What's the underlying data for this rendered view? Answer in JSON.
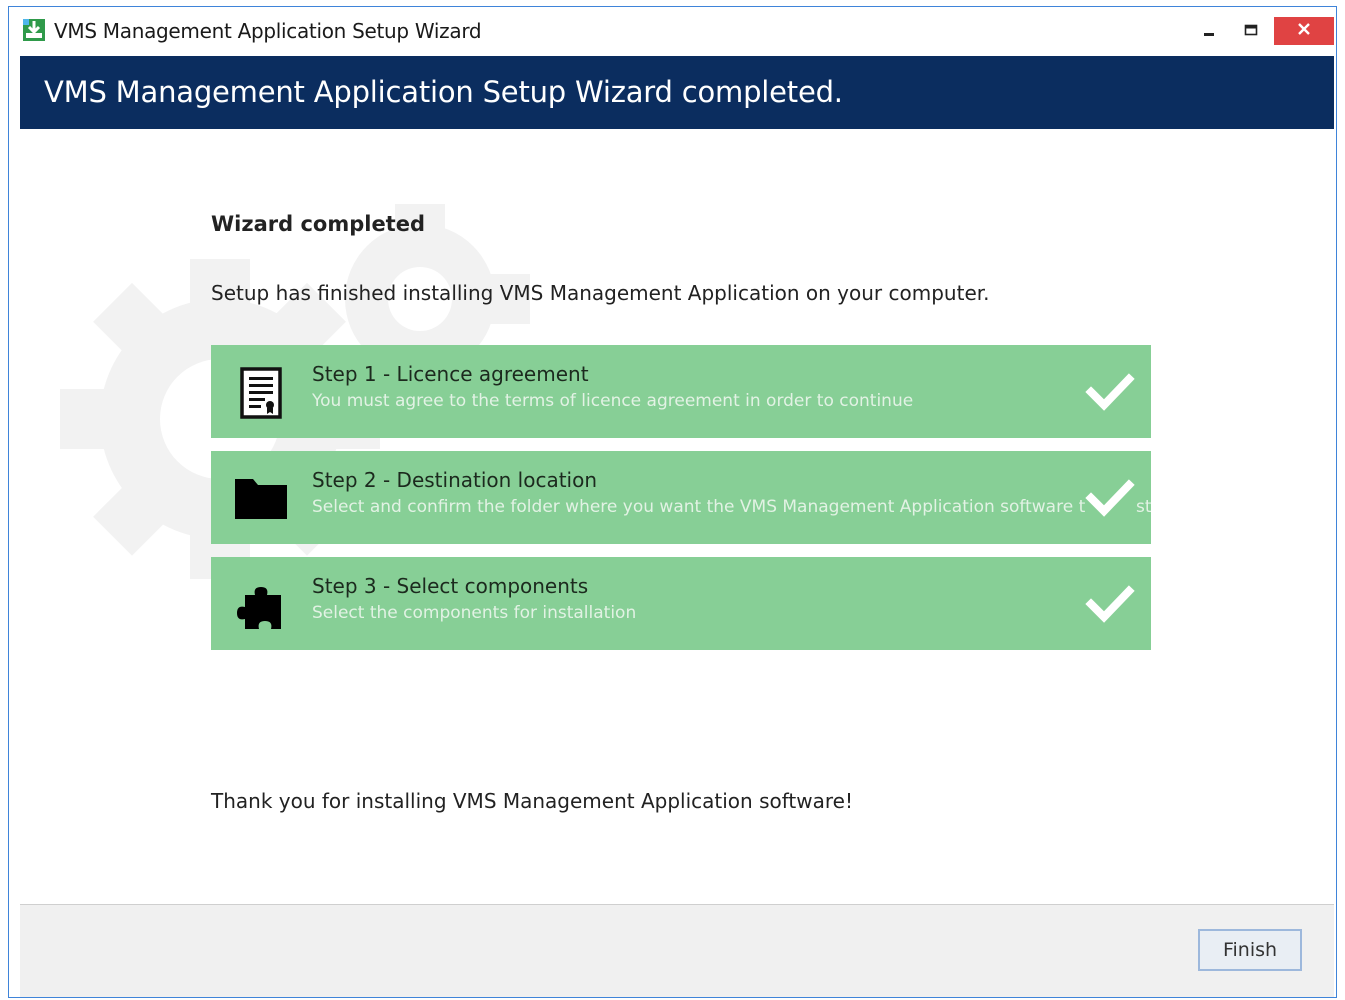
{
  "window": {
    "title": "VMS Management Application Setup Wizard",
    "icon": "installer-icon",
    "controls": [
      "minimize-icon",
      "maximize-icon",
      "close-icon"
    ],
    "close_color": "#e04343"
  },
  "banner": {
    "text": "VMS Management Application Setup Wizard completed.",
    "background": "#0b2d5f"
  },
  "content": {
    "heading": "Wizard completed",
    "intro": "Setup has finished installing VMS Management Application on your computer.",
    "thanks": "Thank you for installing VMS Management Application software!"
  },
  "steps": [
    {
      "title": "Step 1 - Licence agreement",
      "description": "You must agree to the terms of licence agreement in order to continue",
      "icon": "document-icon",
      "status": "completed",
      "status_icon": "checkmark-icon"
    },
    {
      "title": "Step 2 - Destination location",
      "description": "Select and confirm the folder where you want the VMS Management Application software to",
      "tail": "st",
      "icon": "folder-icon",
      "status": "completed",
      "status_icon": "checkmark-icon"
    },
    {
      "title": "Step 3 - Select components",
      "description": "Select the components for installation",
      "icon": "puzzle-icon",
      "status": "completed",
      "status_icon": "checkmark-icon"
    }
  ],
  "step_color": "#87cf96",
  "footer": {
    "finish_label": "Finish"
  }
}
